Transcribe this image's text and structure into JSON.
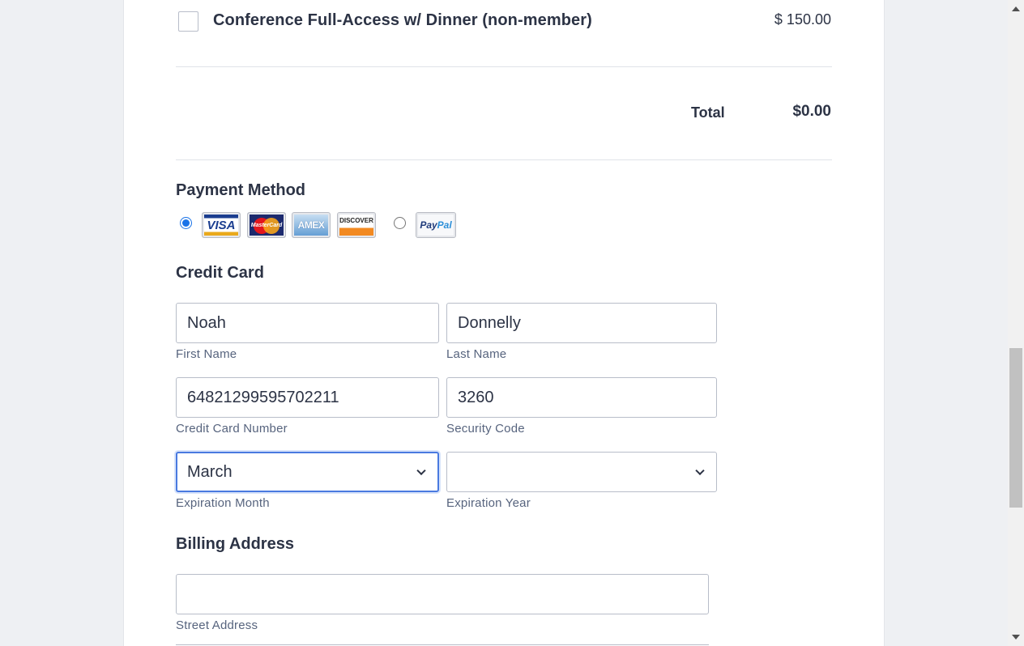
{
  "product": {
    "name": "Conference Full-Access w/ Dinner (non-member)",
    "price": "$ 150.00",
    "checked": false
  },
  "total": {
    "label": "Total",
    "value": "$0.00"
  },
  "payment": {
    "title": "Payment Method",
    "credit_selected": true,
    "paypal_selected": false,
    "logos": {
      "visa": "VISA",
      "mastercard": "MasterCard",
      "amex": "AMEX",
      "discover": "DISCOVER",
      "paypal_a": "Pay",
      "paypal_b": "Pal"
    }
  },
  "credit_card": {
    "title": "Credit Card",
    "first_name": {
      "value": "Noah",
      "label": "First Name"
    },
    "last_name": {
      "value": "Donnelly",
      "label": "Last Name"
    },
    "card_number": {
      "value": "64821299595702211",
      "label": "Credit Card Number"
    },
    "security_code": {
      "value": "3260",
      "label": "Security Code"
    },
    "exp_month": {
      "value": "March",
      "label": "Expiration Month"
    },
    "exp_year": {
      "value": "",
      "label": "Expiration Year"
    }
  },
  "billing": {
    "title": "Billing Address",
    "street": {
      "value": "",
      "label": "Street Address"
    }
  },
  "colors": {
    "accent": "#1a73e8",
    "focus_border": "#4a7ae0",
    "text": "#2c3345",
    "sublabel": "#57647e"
  }
}
